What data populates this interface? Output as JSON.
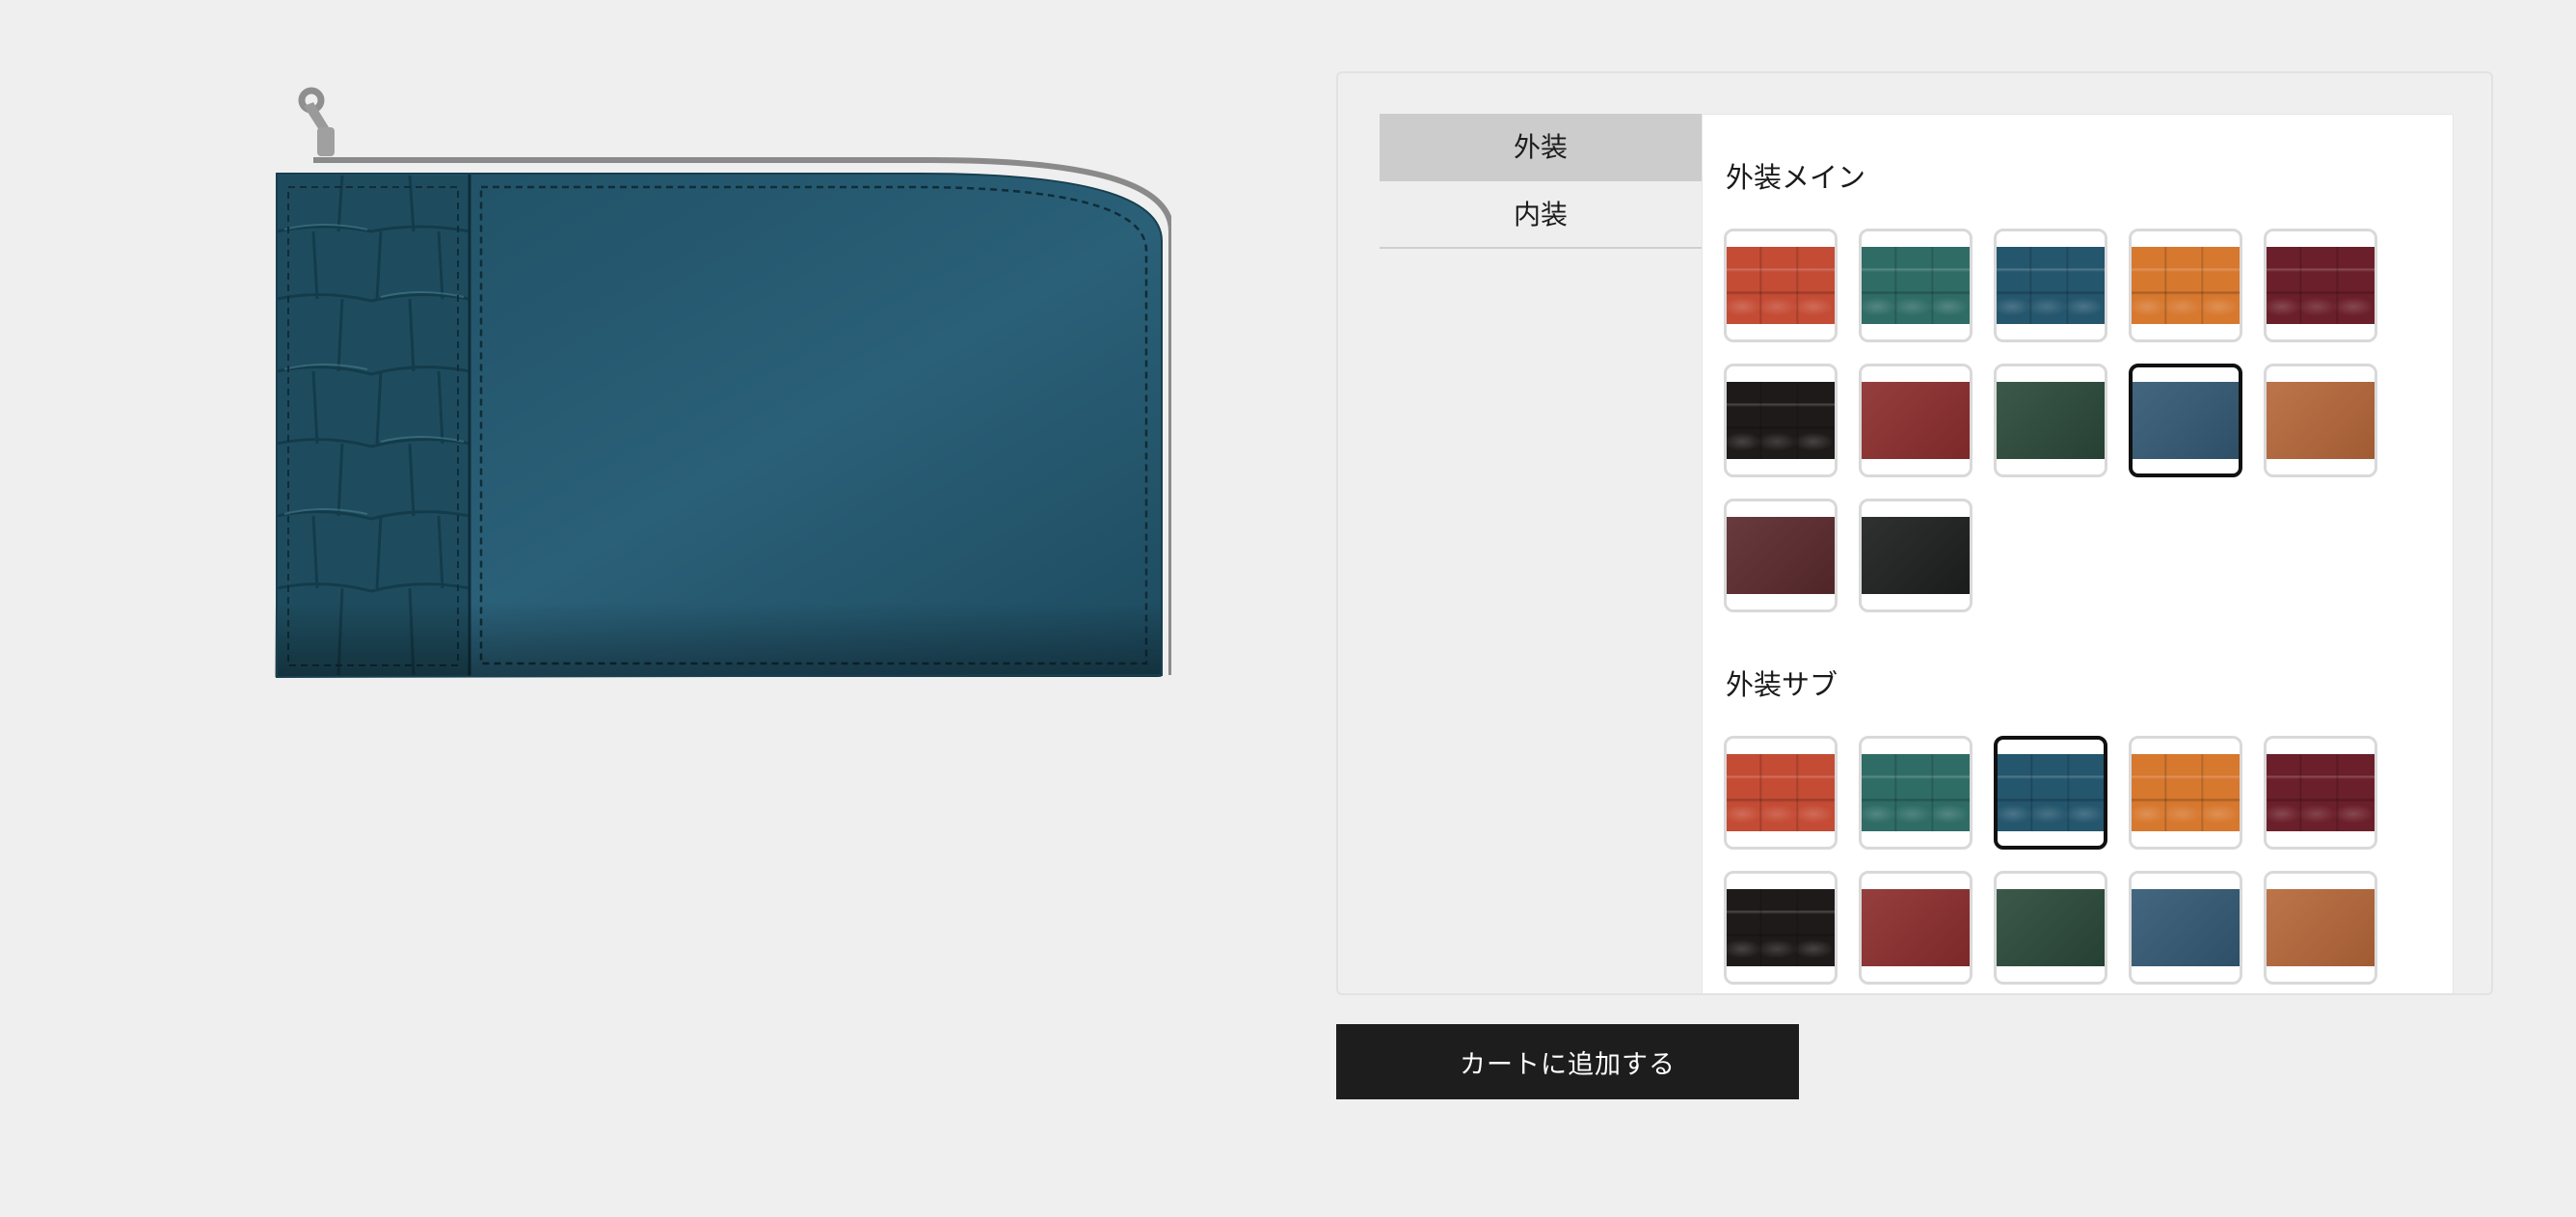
{
  "tabs": [
    {
      "label": "外装",
      "active": true
    },
    {
      "label": "内装",
      "active": false
    }
  ],
  "sections": [
    {
      "title": "外装メイン",
      "selected_index": 8,
      "swatches": [
        {
          "color": "#c44b34",
          "texture": "croc"
        },
        {
          "color": "#2f6c66",
          "texture": "croc"
        },
        {
          "color": "#24566d",
          "texture": "croc"
        },
        {
          "color": "#d7782f",
          "texture": "croc"
        },
        {
          "color": "#6b1f2a",
          "texture": "croc"
        },
        {
          "color": "#1f1a1a",
          "texture": "croc"
        },
        {
          "color": "#8d2e2e",
          "texture": "smooth"
        },
        {
          "color": "#2b4a3a",
          "texture": "smooth"
        },
        {
          "color": "#345a75",
          "texture": "smooth"
        },
        {
          "color": "#b7683a",
          "texture": "smooth"
        },
        {
          "color": "#5b2a2e",
          "texture": "smooth"
        },
        {
          "color": "#1e201f",
          "texture": "smooth"
        }
      ]
    },
    {
      "title": "外装サブ",
      "selected_index": 2,
      "swatches": [
        {
          "color": "#c44b34",
          "texture": "croc"
        },
        {
          "color": "#2f6c66",
          "texture": "croc"
        },
        {
          "color": "#24566d",
          "texture": "croc"
        },
        {
          "color": "#d7782f",
          "texture": "croc"
        },
        {
          "color": "#6b1f2a",
          "texture": "croc"
        },
        {
          "color": "#1f1a1a",
          "texture": "croc"
        },
        {
          "color": "#8d2e2e",
          "texture": "smooth"
        },
        {
          "color": "#2b4a3a",
          "texture": "smooth"
        },
        {
          "color": "#345a75",
          "texture": "smooth"
        },
        {
          "color": "#b7683a",
          "texture": "smooth"
        }
      ]
    }
  ],
  "preview": {
    "main_color": "#24566d",
    "sub_color": "#24566d",
    "zipper_color": "#8a8a8a"
  },
  "cart_button": {
    "label": "カートに追加する"
  }
}
